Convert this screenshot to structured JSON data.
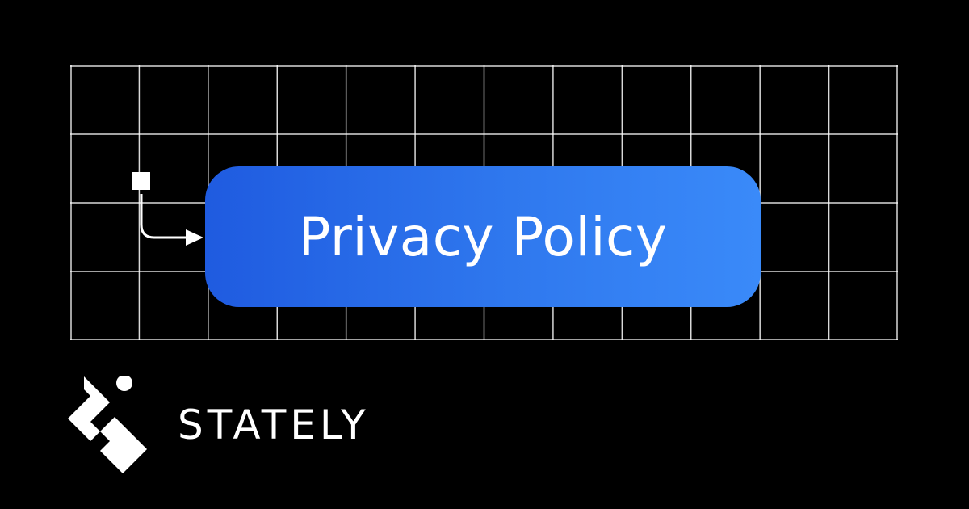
{
  "state_node": {
    "label": "Privacy Policy"
  },
  "brand": {
    "name": "STATELY",
    "logo_icon": "stately-logo-icon"
  },
  "colors": {
    "background": "#000000",
    "grid_line": "#ffffff",
    "node_gradient_start": "#1f5be0",
    "node_gradient_end": "#3a8af9",
    "text": "#ffffff"
  },
  "grid": {
    "columns": 12,
    "rows": 4
  }
}
